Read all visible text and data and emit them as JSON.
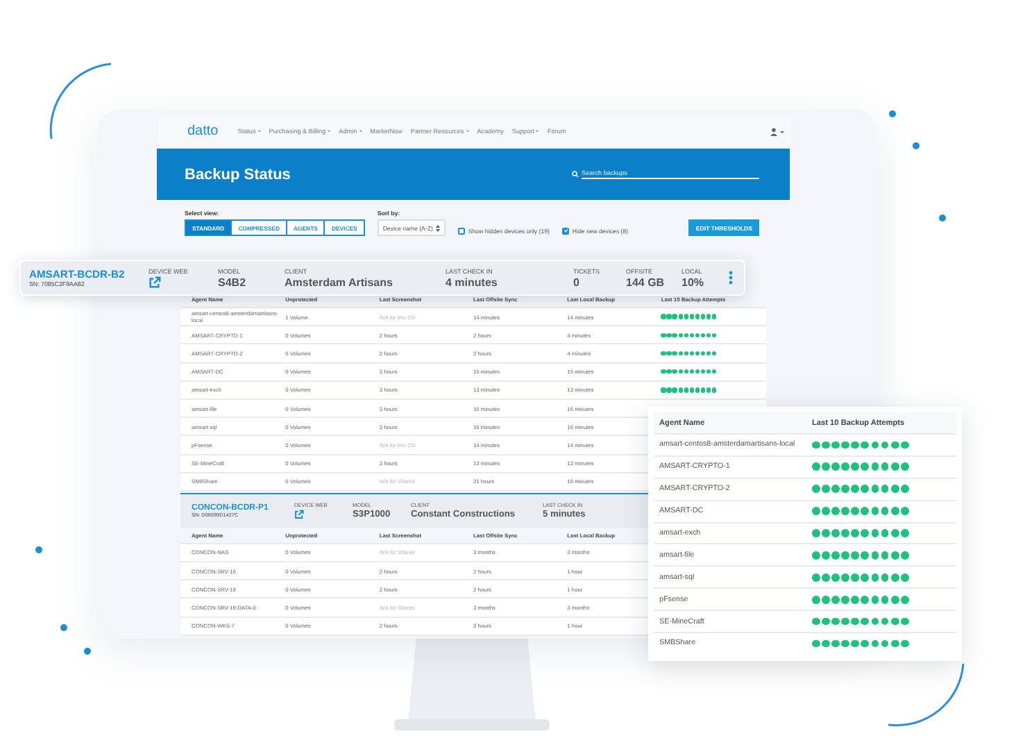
{
  "nav": {
    "logo": "datto",
    "items": [
      {
        "label": "Status",
        "dropdown": true
      },
      {
        "label": "Purchasing & Billing",
        "dropdown": true
      },
      {
        "label": "Admin",
        "dropdown": true
      },
      {
        "label": "MarketNow",
        "dropdown": false
      },
      {
        "label": "Partner Resources",
        "dropdown": true
      },
      {
        "label": "Academy",
        "dropdown": false
      },
      {
        "label": "Support",
        "dropdown": true
      },
      {
        "label": "Forum",
        "dropdown": false
      }
    ]
  },
  "header": {
    "title": "Backup Status",
    "search": {
      "placeholder": "Search backups"
    }
  },
  "controls": {
    "view_label": "Select view:",
    "views": [
      {
        "label": "STANDARD",
        "selected": true
      },
      {
        "label": "COMPRESSED",
        "selected": false
      },
      {
        "label": "AGENTS",
        "selected": false
      },
      {
        "label": "DEVICES",
        "selected": false
      }
    ],
    "sort_label": "Sort by:",
    "sort": {
      "value": "Device name (A-Z)"
    },
    "filters": [
      {
        "label": "Show hidden devices only (19)",
        "checked": false
      },
      {
        "label": "Hide new devices (8)",
        "checked": true
      }
    ],
    "action": "EDIT THRESHOLDS"
  },
  "devices": [
    {
      "kind": "floating",
      "name": "AMSART-BCDR-B2",
      "serial": "SN: 7085C2F9AA82",
      "menu": true,
      "fields": [
        {
          "kind": "link",
          "label": "DEVICE WEB"
        },
        {
          "kind": "text",
          "label": "MODEL",
          "value": "S4B2"
        },
        {
          "kind": "text",
          "label": "CLIENT",
          "value": "Amsterdam Artisans"
        },
        {
          "kind": "text",
          "label": "LAST CHECK IN",
          "value": "4 minutes"
        },
        {
          "kind": "text",
          "label": "TICKETS",
          "value": "0"
        },
        {
          "kind": "text",
          "label": "OFFSITE",
          "value": "144 GB"
        },
        {
          "kind": "text",
          "label": "LOCAL",
          "value": "10%"
        }
      ],
      "columns": [
        "Agent Name",
        "Unprotected",
        "Last Screenshot",
        "Last Offsite Sync",
        "Last Local Backup",
        "Last 10 Backup Attempts"
      ],
      "rows": [
        {
          "cells": [
            "amsart-centos8-amsterdamartisans-local",
            "1 Volume",
            "N/A for this OS",
            "14 minutes",
            "14 minutes"
          ],
          "muted": [
            false,
            false,
            true,
            false,
            false
          ],
          "attempts_ok": [
            true,
            true,
            true,
            true,
            true,
            true,
            true,
            true,
            true,
            true
          ]
        },
        {
          "cells": [
            "AMSART-CRYPTO-1",
            "0 Volumes",
            "2 hours",
            "2 hours",
            "4 minutes"
          ],
          "muted": [
            false,
            false,
            false,
            false,
            false
          ],
          "attempts_ok": [
            true,
            true,
            true,
            true,
            true,
            true,
            true,
            true,
            true,
            true
          ]
        },
        {
          "cells": [
            "AMSART-CRYPTO-2",
            "0 Volumes",
            "2 hours",
            "2 hours",
            "4 minutes"
          ],
          "muted": [
            false,
            false,
            false,
            false,
            false
          ],
          "attempts_ok": [
            true,
            true,
            true,
            true,
            true,
            true,
            true,
            true,
            true,
            true
          ]
        },
        {
          "cells": [
            "AMSART-DC",
            "0 Volumes",
            "3 hours",
            "15 minutes",
            "15 minutes"
          ],
          "muted": [
            false,
            false,
            false,
            false,
            false
          ],
          "attempts_ok": [
            true,
            true,
            true,
            true,
            true,
            true,
            true,
            true,
            true,
            true
          ]
        },
        {
          "cells": [
            "amsart-exch",
            "0 Volumes",
            "3 hours",
            "13 minutes",
            "13 minutes"
          ],
          "muted": [
            false,
            false,
            false,
            false,
            false
          ],
          "attempts_ok": [
            true,
            true,
            true,
            true,
            true,
            true,
            true,
            true,
            true,
            true
          ]
        },
        {
          "cells": [
            "amsart-file",
            "0 Volumes",
            "3 hours",
            "16 minutes",
            "16 minutes"
          ],
          "muted": [
            false,
            false,
            false,
            false,
            false
          ]
        },
        {
          "cells": [
            "amsart-sql",
            "0 Volumes",
            "3 hours",
            "16 minutes",
            "16 minutes"
          ],
          "muted": [
            false,
            false,
            false,
            false,
            false
          ]
        },
        {
          "cells": [
            "pFsense",
            "0 Volumes",
            "N/A for this OS",
            "14 minutes",
            "14 minutes"
          ],
          "muted": [
            false,
            false,
            true,
            false,
            false
          ]
        },
        {
          "cells": [
            "SE-MineCraft",
            "0 Volumes",
            "3 hours",
            "13 minutes",
            "13 minutes"
          ],
          "muted": [
            false,
            false,
            false,
            false,
            false
          ]
        },
        {
          "cells": [
            "SMBShare",
            "0 Volumes",
            "N/A for Shares",
            "21 hours",
            "16 minutes"
          ],
          "muted": [
            false,
            false,
            true,
            false,
            false
          ]
        }
      ]
    },
    {
      "kind": "inline",
      "name": "CONCON-BCDR-P1",
      "serial": "SN: D05099D1427C",
      "fields": [
        {
          "kind": "link",
          "label": "DEVICE WEB"
        },
        {
          "kind": "text",
          "label": "MODEL",
          "value": "S3P1000"
        },
        {
          "kind": "text",
          "label": "CLIENT",
          "value": "Constant Constructions"
        },
        {
          "kind": "text",
          "label": "LAST CHECK IN",
          "value": "5 minutes"
        }
      ],
      "columns": [
        "Agent Name",
        "Unprotected",
        "Last Screenshot",
        "Last Offsite Sync",
        "Last Local Backup"
      ],
      "rows": [
        {
          "cells": [
            "CONCON-NAS",
            "0 Volumes",
            "N/A for Shares",
            "3 months",
            "3 months"
          ],
          "muted": [
            false,
            false,
            true,
            false,
            false
          ]
        },
        {
          "cells": [
            "CONCON-SRV-16",
            "0 Volumes",
            "2 hours",
            "2 hours",
            "1 hour"
          ],
          "muted": [
            false,
            false,
            false,
            false,
            false
          ]
        },
        {
          "cells": [
            "CONCON-SRV-19",
            "0 Volumes",
            "2 hours",
            "2 hours",
            "1 hour"
          ],
          "muted": [
            false,
            false,
            false,
            false,
            false
          ]
        },
        {
          "cells": [
            "CONCON-SRV-19-DATA-E",
            "0 Volumes",
            "N/A for Shares",
            "3 months",
            "3 months"
          ],
          "muted": [
            false,
            false,
            true,
            false,
            false
          ]
        },
        {
          "cells": [
            "CONCON-WKS-7",
            "0 Volumes",
            "2 hours",
            "2 hours",
            "1 hour"
          ],
          "muted": [
            false,
            false,
            false,
            false,
            false
          ]
        }
      ]
    }
  ],
  "panel": {
    "columns": [
      "Agent Name",
      "Last 10 Backup Attempts"
    ],
    "rows": [
      {
        "agent": "amsart-centos8-amsterdamartisans-local",
        "attempts_ok": [
          true,
          true,
          true,
          true,
          true,
          true,
          true,
          true,
          true,
          true
        ]
      },
      {
        "agent": "AMSART-CRYPTO-1",
        "attempts_ok": [
          true,
          true,
          true,
          true,
          true,
          true,
          true,
          true,
          true,
          true
        ]
      },
      {
        "agent": "AMSART-CRYPTO-2",
        "attempts_ok": [
          true,
          true,
          true,
          true,
          true,
          true,
          true,
          true,
          true,
          true
        ]
      },
      {
        "agent": "AMSART-DC",
        "attempts_ok": [
          true,
          true,
          true,
          true,
          true,
          true,
          true,
          true,
          true,
          true
        ]
      },
      {
        "agent": "amsart-exch",
        "attempts_ok": [
          true,
          true,
          true,
          true,
          true,
          true,
          true,
          true,
          true,
          true
        ]
      },
      {
        "agent": "amsart-file",
        "attempts_ok": [
          true,
          true,
          true,
          true,
          true,
          true,
          true,
          true,
          true,
          true
        ]
      },
      {
        "agent": "amsart-sql",
        "attempts_ok": [
          true,
          true,
          true,
          true,
          true,
          true,
          true,
          true,
          true,
          true
        ]
      },
      {
        "agent": "pFsense",
        "attempts_ok": [
          true,
          true,
          true,
          true,
          true,
          true,
          true,
          true,
          true,
          true
        ]
      },
      {
        "agent": "SE-MineCraft",
        "attempts_ok": [
          true,
          true,
          true,
          true,
          true,
          true,
          true,
          true,
          true,
          true
        ]
      },
      {
        "agent": "SMBShare",
        "attempts_ok": [
          true,
          true,
          true,
          true,
          true,
          true,
          true,
          true,
          true,
          true
        ]
      }
    ]
  }
}
